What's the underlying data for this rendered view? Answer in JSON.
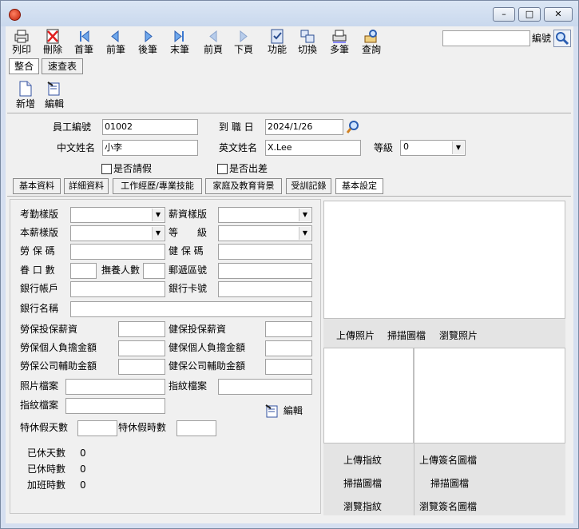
{
  "window": {
    "app_icon": "globe-icon",
    "minimize": "–",
    "maximize": "□",
    "close": "✕"
  },
  "toolbar": [
    {
      "label": "列印",
      "icon": "print-icon"
    },
    {
      "label": "刪除",
      "icon": "delete-icon"
    },
    {
      "label": "首筆",
      "icon": "first-record-icon"
    },
    {
      "label": "前筆",
      "icon": "prev-record-icon"
    },
    {
      "label": "後筆",
      "icon": "next-record-icon"
    },
    {
      "label": "末筆",
      "icon": "last-record-icon"
    },
    {
      "label": "前頁",
      "icon": "prev-page-icon"
    },
    {
      "label": "下頁",
      "icon": "next-page-icon"
    },
    {
      "label": "功能",
      "icon": "function-icon"
    },
    {
      "label": "切換",
      "icon": "switch-icon"
    },
    {
      "label": "多筆",
      "icon": "multi-record-icon"
    },
    {
      "label": "查詢",
      "icon": "query-icon"
    }
  ],
  "search": {
    "value": "",
    "label": "編號"
  },
  "view_tabs": [
    "整合",
    "速查表"
  ],
  "actions": {
    "new": "新增",
    "edit": "編輯"
  },
  "header": {
    "emp_id_label": "員工編號",
    "emp_id": "01002",
    "hire_date_label": "到 職 日",
    "hire_date": "2024/1/26",
    "cn_name_label": "中文姓名",
    "cn_name": "小李",
    "en_name_label": "英文姓名",
    "en_name": "X.Lee",
    "grade_label": "等級",
    "grade": "0",
    "leave_label": "是否請假",
    "business_trip_label": "是否出差"
  },
  "tabs": [
    "基本資料",
    "詳細資料",
    "工作經歷/專業技能",
    "家庭及教育背景",
    "受訓記錄",
    "基本設定"
  ],
  "form": {
    "attendance_template": "考勤樣版",
    "salary_template": "薪資樣版",
    "base_salary_template": "本薪樣版",
    "level": "等　　級",
    "labor_ins_code": "勞 保 碼",
    "health_ins_code": "健 保 碼",
    "dependents": "眷 口 數",
    "support_count": "撫養人數",
    "postal_code": "郵遞區號",
    "bank_account": "銀行帳戶",
    "bank_card": "銀行卡號",
    "bank_name": "銀行名稱",
    "labor_ins_salary": "勞保投保薪資",
    "health_ins_salary": "健保投保薪資",
    "labor_personal": "勞保個人負擔金額",
    "health_personal": "健保個人負擔金額",
    "labor_company": "勞保公司輔助金額",
    "health_company": "健保公司輔助金額",
    "photo_file": "照片檔案",
    "fingerprint_file": "指紋檔案",
    "fingerprint_file2": "指紋檔案",
    "edit": "編輯",
    "special_leave_days": "特休假天數",
    "special_leave_hours": "特休假時數",
    "used_days_label": "已休天數",
    "used_days": "0",
    "used_hours_label": "已休時數",
    "used_hours": "0",
    "overtime_label": "加班時數",
    "overtime": "0"
  },
  "photo_panel": {
    "upload": "上傳照片",
    "scan": "掃描圖檔",
    "browse": "瀏覽照片"
  },
  "fingerprint_panel": {
    "upload": "上傳指紋",
    "scan": "掃描圖檔",
    "browse": "瀏覽指紋"
  },
  "signature_panel": {
    "upload": "上傳簽名圖檔",
    "scan": "掃描圖檔",
    "browse": "瀏覽簽名圖檔"
  }
}
